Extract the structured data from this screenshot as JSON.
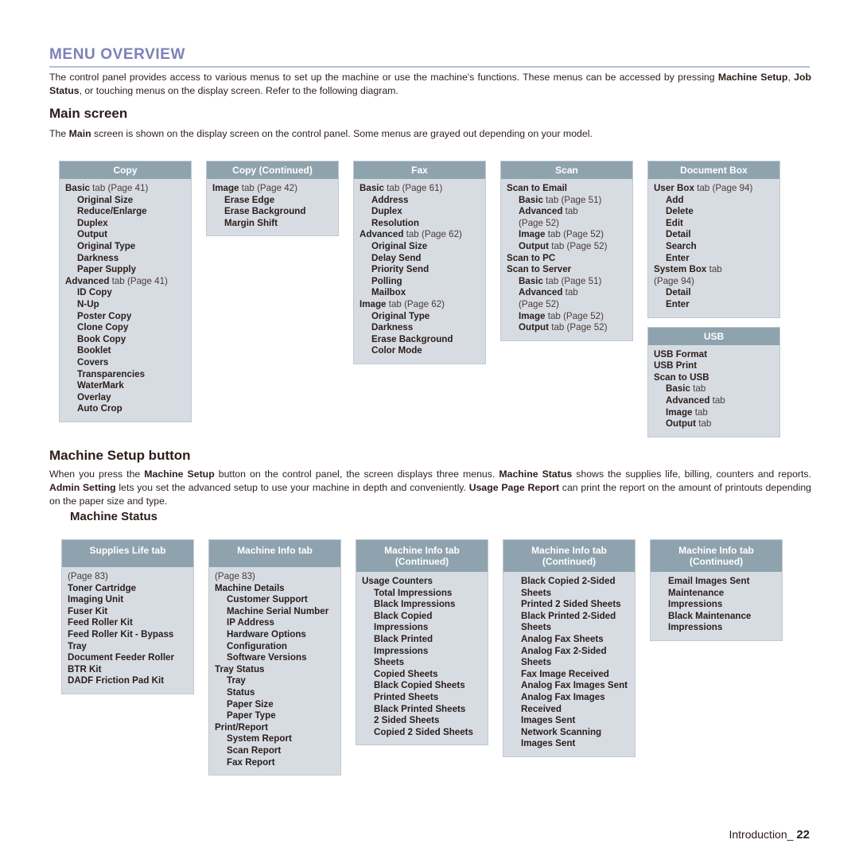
{
  "page": {
    "title": "MENU OVERVIEW",
    "intro_parts": [
      {
        "t": "The control panel provides access to various menus to set up the machine or use the machine's functions. These menus can be accessed by pressing ",
        "b": false
      },
      {
        "t": "Machine Setup",
        "b": true
      },
      {
        "t": ", ",
        "b": false
      },
      {
        "t": "Job Status",
        "b": true
      },
      {
        "t": ", or touching menus on the display screen. Refer to the following diagram.",
        "b": false
      }
    ],
    "main_screen_heading": "Main screen",
    "main_screen_parts": [
      {
        "t": "The ",
        "b": false
      },
      {
        "t": "Main",
        "b": true
      },
      {
        "t": " screen is shown on the display screen on the control panel. Some menus are grayed out depending on your model.",
        "b": false
      }
    ],
    "machine_setup_heading": "Machine Setup button",
    "machine_setup_parts": [
      {
        "t": "When you press the ",
        "b": false
      },
      {
        "t": "Machine Setup",
        "b": true
      },
      {
        "t": " button on the control panel, the screen displays three menus. ",
        "b": false
      },
      {
        "t": "Machine Status",
        "b": true
      },
      {
        "t": " shows the supplies life, billing, counters and reports. ",
        "b": false
      },
      {
        "t": "Admin Setting",
        "b": true
      },
      {
        "t": " lets you set the advanced setup to use your machine in depth and conveniently. ",
        "b": false
      },
      {
        "t": "Usage Page Report",
        "b": true
      },
      {
        "t": " can print the report on the amount of printouts depending on the paper size and type.",
        "b": false
      }
    ],
    "machine_status_heading": "Machine Status",
    "footer_label": "Introduction_",
    "footer_page": "22"
  },
  "colors": {
    "heading": "#7d81b8",
    "box_header": "#8fa3ae",
    "box_body": "#d7dce3",
    "text": "#2b1d1a"
  },
  "main_screen_columns": [
    {
      "boxes": [
        {
          "header": "Copy",
          "header_lines": [
            "Copy"
          ],
          "items": [
            {
              "level": 0,
              "bold": "Basic",
              "rest": " tab (Page 41)"
            },
            {
              "level": 1,
              "bold": "Original Size",
              "rest": ""
            },
            {
              "level": 1,
              "bold": "Reduce/Enlarge",
              "rest": ""
            },
            {
              "level": 1,
              "bold": "Duplex",
              "rest": ""
            },
            {
              "level": 1,
              "bold": "Output",
              "rest": ""
            },
            {
              "level": 1,
              "bold": "Original Type",
              "rest": ""
            },
            {
              "level": 1,
              "bold": "Darkness",
              "rest": ""
            },
            {
              "level": 1,
              "bold": "Paper Supply",
              "rest": ""
            },
            {
              "level": 0,
              "bold": "Advanced",
              "rest": " tab (Page 41)"
            },
            {
              "level": 1,
              "bold": "ID Copy",
              "rest": ""
            },
            {
              "level": 1,
              "bold": "N-Up",
              "rest": ""
            },
            {
              "level": 1,
              "bold": "Poster Copy",
              "rest": ""
            },
            {
              "level": 1,
              "bold": "Clone Copy",
              "rest": ""
            },
            {
              "level": 1,
              "bold": "Book Copy",
              "rest": ""
            },
            {
              "level": 1,
              "bold": "Booklet",
              "rest": ""
            },
            {
              "level": 1,
              "bold": "Covers",
              "rest": ""
            },
            {
              "level": 1,
              "bold": "Transparencies",
              "rest": ""
            },
            {
              "level": 1,
              "bold": "WaterMark",
              "rest": ""
            },
            {
              "level": 1,
              "bold": "Overlay",
              "rest": ""
            },
            {
              "level": 1,
              "bold": "Auto Crop",
              "rest": ""
            }
          ]
        }
      ]
    },
    {
      "boxes": [
        {
          "header": "Copy (Continued)",
          "header_lines": [
            "Copy (Continued)"
          ],
          "items": [
            {
              "level": 0,
              "bold": "Image",
              "rest": " tab (Page 42)"
            },
            {
              "level": 1,
              "bold": "Erase Edge",
              "rest": ""
            },
            {
              "level": 1,
              "bold": "Erase Background",
              "rest": ""
            },
            {
              "level": 1,
              "bold": "Margin Shift",
              "rest": ""
            }
          ]
        }
      ]
    },
    {
      "boxes": [
        {
          "header": "Fax",
          "header_lines": [
            "Fax"
          ],
          "items": [
            {
              "level": 0,
              "bold": "Basic",
              "rest": " tab (Page 61)"
            },
            {
              "level": 1,
              "bold": "Address",
              "rest": ""
            },
            {
              "level": 1,
              "bold": "Duplex",
              "rest": ""
            },
            {
              "level": 1,
              "bold": "Resolution",
              "rest": ""
            },
            {
              "level": 0,
              "bold": "Advanced",
              "rest": " tab (Page 62)"
            },
            {
              "level": 1,
              "bold": "Original Size",
              "rest": ""
            },
            {
              "level": 1,
              "bold": "Delay Send",
              "rest": ""
            },
            {
              "level": 1,
              "bold": "Priority Send",
              "rest": ""
            },
            {
              "level": 1,
              "bold": "Polling",
              "rest": ""
            },
            {
              "level": 1,
              "bold": "Mailbox",
              "rest": ""
            },
            {
              "level": 0,
              "bold": "Image",
              "rest": " tab (Page 62)"
            },
            {
              "level": 1,
              "bold": "Original Type",
              "rest": ""
            },
            {
              "level": 1,
              "bold": "Darkness",
              "rest": ""
            },
            {
              "level": 1,
              "bold": "Erase Background",
              "rest": ""
            },
            {
              "level": 1,
              "bold": "Color Mode",
              "rest": ""
            }
          ]
        }
      ]
    },
    {
      "boxes": [
        {
          "header": "Scan",
          "header_lines": [
            "Scan"
          ],
          "items": [
            {
              "level": 0,
              "bold": "Scan to Email",
              "rest": ""
            },
            {
              "level": 1,
              "bold": "Basic",
              "rest": " tab (Page 51)"
            },
            {
              "level": 1,
              "bold": "Advanced",
              "rest": " tab"
            },
            {
              "level": 1,
              "bold": "",
              "rest": "(Page 52)"
            },
            {
              "level": 1,
              "bold": "Image",
              "rest": " tab (Page 52)"
            },
            {
              "level": 1,
              "bold": "Output",
              "rest": " tab (Page 52)"
            },
            {
              "level": 0,
              "bold": "Scan to PC",
              "rest": ""
            },
            {
              "level": 0,
              "bold": "Scan to Server",
              "rest": ""
            },
            {
              "level": 1,
              "bold": "Basic",
              "rest": " tab (Page 51)"
            },
            {
              "level": 1,
              "bold": "Advanced",
              "rest": " tab"
            },
            {
              "level": 1,
              "bold": "",
              "rest": "(Page 52)"
            },
            {
              "level": 1,
              "bold": "Image",
              "rest": " tab (Page 52)"
            },
            {
              "level": 1,
              "bold": "Output",
              "rest": " tab (Page 52)"
            }
          ]
        }
      ]
    },
    {
      "boxes": [
        {
          "header": "Document Box",
          "header_lines": [
            "Document Box"
          ],
          "items": [
            {
              "level": 0,
              "bold": "User Box",
              "rest": " tab (Page 94)"
            },
            {
              "level": 1,
              "bold": "Add",
              "rest": ""
            },
            {
              "level": 1,
              "bold": "Delete",
              "rest": ""
            },
            {
              "level": 1,
              "bold": "Edit",
              "rest": ""
            },
            {
              "level": 1,
              "bold": "Detail",
              "rest": ""
            },
            {
              "level": 1,
              "bold": "Search",
              "rest": ""
            },
            {
              "level": 1,
              "bold": "Enter",
              "rest": ""
            },
            {
              "level": 0,
              "bold": "System Box",
              "rest": " tab"
            },
            {
              "level": 0,
              "bold": "",
              "rest": "(Page 94)"
            },
            {
              "level": 1,
              "bold": "Detail",
              "rest": ""
            },
            {
              "level": 1,
              "bold": "Enter",
              "rest": ""
            }
          ]
        },
        {
          "header": "USB",
          "header_lines": [
            "USB"
          ],
          "items": [
            {
              "level": 0,
              "bold": "USB Format",
              "rest": ""
            },
            {
              "level": 0,
              "bold": "USB Print",
              "rest": ""
            },
            {
              "level": 0,
              "bold": "Scan to USB",
              "rest": ""
            },
            {
              "level": 1,
              "bold": "Basic",
              "rest": " tab"
            },
            {
              "level": 1,
              "bold": "Advanced",
              "rest": " tab"
            },
            {
              "level": 1,
              "bold": "Image",
              "rest": " tab"
            },
            {
              "level": 1,
              "bold": "Output",
              "rest": " tab"
            }
          ]
        }
      ]
    }
  ],
  "machine_status_columns": [
    {
      "header_lines": [
        "Supplies Life tab"
      ],
      "items": [
        {
          "level": 0,
          "bold": "",
          "rest": "(Page 83)"
        },
        {
          "level": 0,
          "bold": "Toner Cartridge",
          "rest": ""
        },
        {
          "level": 0,
          "bold": "Imaging Unit",
          "rest": ""
        },
        {
          "level": 0,
          "bold": "Fuser Kit",
          "rest": ""
        },
        {
          "level": 0,
          "bold": "Feed Roller Kit",
          "rest": ""
        },
        {
          "level": 0,
          "bold": "Feed Roller Kit - Bypass Tray",
          "rest": ""
        },
        {
          "level": 0,
          "bold": "Document Feeder Roller",
          "rest": ""
        },
        {
          "level": 0,
          "bold": "BTR Kit",
          "rest": ""
        },
        {
          "level": 0,
          "bold": "DADF Friction Pad Kit",
          "rest": ""
        }
      ]
    },
    {
      "header_lines": [
        "Machine Info tab"
      ],
      "items": [
        {
          "level": 0,
          "bold": "",
          "rest": "(Page 83)"
        },
        {
          "level": 0,
          "bold": "Machine Details",
          "rest": ""
        },
        {
          "level": 1,
          "bold": "Customer Support",
          "rest": ""
        },
        {
          "level": 1,
          "bold": "Machine Serial Number",
          "rest": ""
        },
        {
          "level": 1,
          "bold": "IP Address",
          "rest": ""
        },
        {
          "level": 1,
          "bold": "Hardware Options",
          "rest": ""
        },
        {
          "level": 1,
          "bold": "Configuration",
          "rest": ""
        },
        {
          "level": 1,
          "bold": "Software Versions",
          "rest": ""
        },
        {
          "level": 0,
          "bold": "Tray Status",
          "rest": ""
        },
        {
          "level": 1,
          "bold": "Tray",
          "rest": ""
        },
        {
          "level": 1,
          "bold": "Status",
          "rest": ""
        },
        {
          "level": 1,
          "bold": "Paper Size",
          "rest": ""
        },
        {
          "level": 1,
          "bold": "Paper Type",
          "rest": ""
        },
        {
          "level": 0,
          "bold": "Print/Report",
          "rest": ""
        },
        {
          "level": 1,
          "bold": "System Report",
          "rest": ""
        },
        {
          "level": 1,
          "bold": "Scan Report",
          "rest": ""
        },
        {
          "level": 1,
          "bold": "Fax Report",
          "rest": ""
        }
      ]
    },
    {
      "header_lines": [
        "Machine Info tab",
        "(Continued)"
      ],
      "items": [
        {
          "level": 0,
          "bold": "Usage Counters",
          "rest": ""
        },
        {
          "level": 1,
          "bold": "Total Impressions",
          "rest": ""
        },
        {
          "level": 1,
          "bold": "Black Impressions",
          "rest": ""
        },
        {
          "level": 1,
          "bold": "Black Copied Impressions",
          "rest": ""
        },
        {
          "level": 1,
          "bold": "Black Printed Impressions",
          "rest": ""
        },
        {
          "level": 1,
          "bold": "Sheets",
          "rest": ""
        },
        {
          "level": 1,
          "bold": "Copied Sheets",
          "rest": ""
        },
        {
          "level": 1,
          "bold": "Black Copied Sheets",
          "rest": ""
        },
        {
          "level": 1,
          "bold": "Printed Sheets",
          "rest": ""
        },
        {
          "level": 1,
          "bold": "Black Printed Sheets",
          "rest": ""
        },
        {
          "level": 1,
          "bold": "2 Sided Sheets",
          "rest": ""
        },
        {
          "level": 1,
          "bold": "Copied 2 Sided Sheets",
          "rest": ""
        }
      ]
    },
    {
      "header_lines": [
        "Machine Info tab",
        "(Continued)"
      ],
      "items": [
        {
          "level": 1,
          "bold": "Black Copied 2-Sided Sheets",
          "rest": ""
        },
        {
          "level": 1,
          "bold": "Printed 2 Sided Sheets",
          "rest": ""
        },
        {
          "level": 1,
          "bold": "Black Printed 2-Sided Sheets",
          "rest": ""
        },
        {
          "level": 1,
          "bold": "Analog Fax Sheets",
          "rest": ""
        },
        {
          "level": 1,
          "bold": "Analog Fax 2-Sided Sheets",
          "rest": ""
        },
        {
          "level": 1,
          "bold": "Fax Image Received",
          "rest": ""
        },
        {
          "level": 1,
          "bold": "Analog Fax Images Sent",
          "rest": ""
        },
        {
          "level": 1,
          "bold": "Analog Fax Images Received",
          "rest": ""
        },
        {
          "level": 1,
          "bold": "Images Sent",
          "rest": ""
        },
        {
          "level": 1,
          "bold": "Network Scanning Images Sent",
          "rest": ""
        }
      ]
    },
    {
      "header_lines": [
        "Machine Info tab",
        "(Continued)"
      ],
      "items": [
        {
          "level": 1,
          "bold": "Email Images Sent",
          "rest": ""
        },
        {
          "level": 1,
          "bold": "Maintenance Impressions",
          "rest": ""
        },
        {
          "level": 1,
          "bold": "Black Maintenance Impressions",
          "rest": ""
        }
      ]
    }
  ]
}
